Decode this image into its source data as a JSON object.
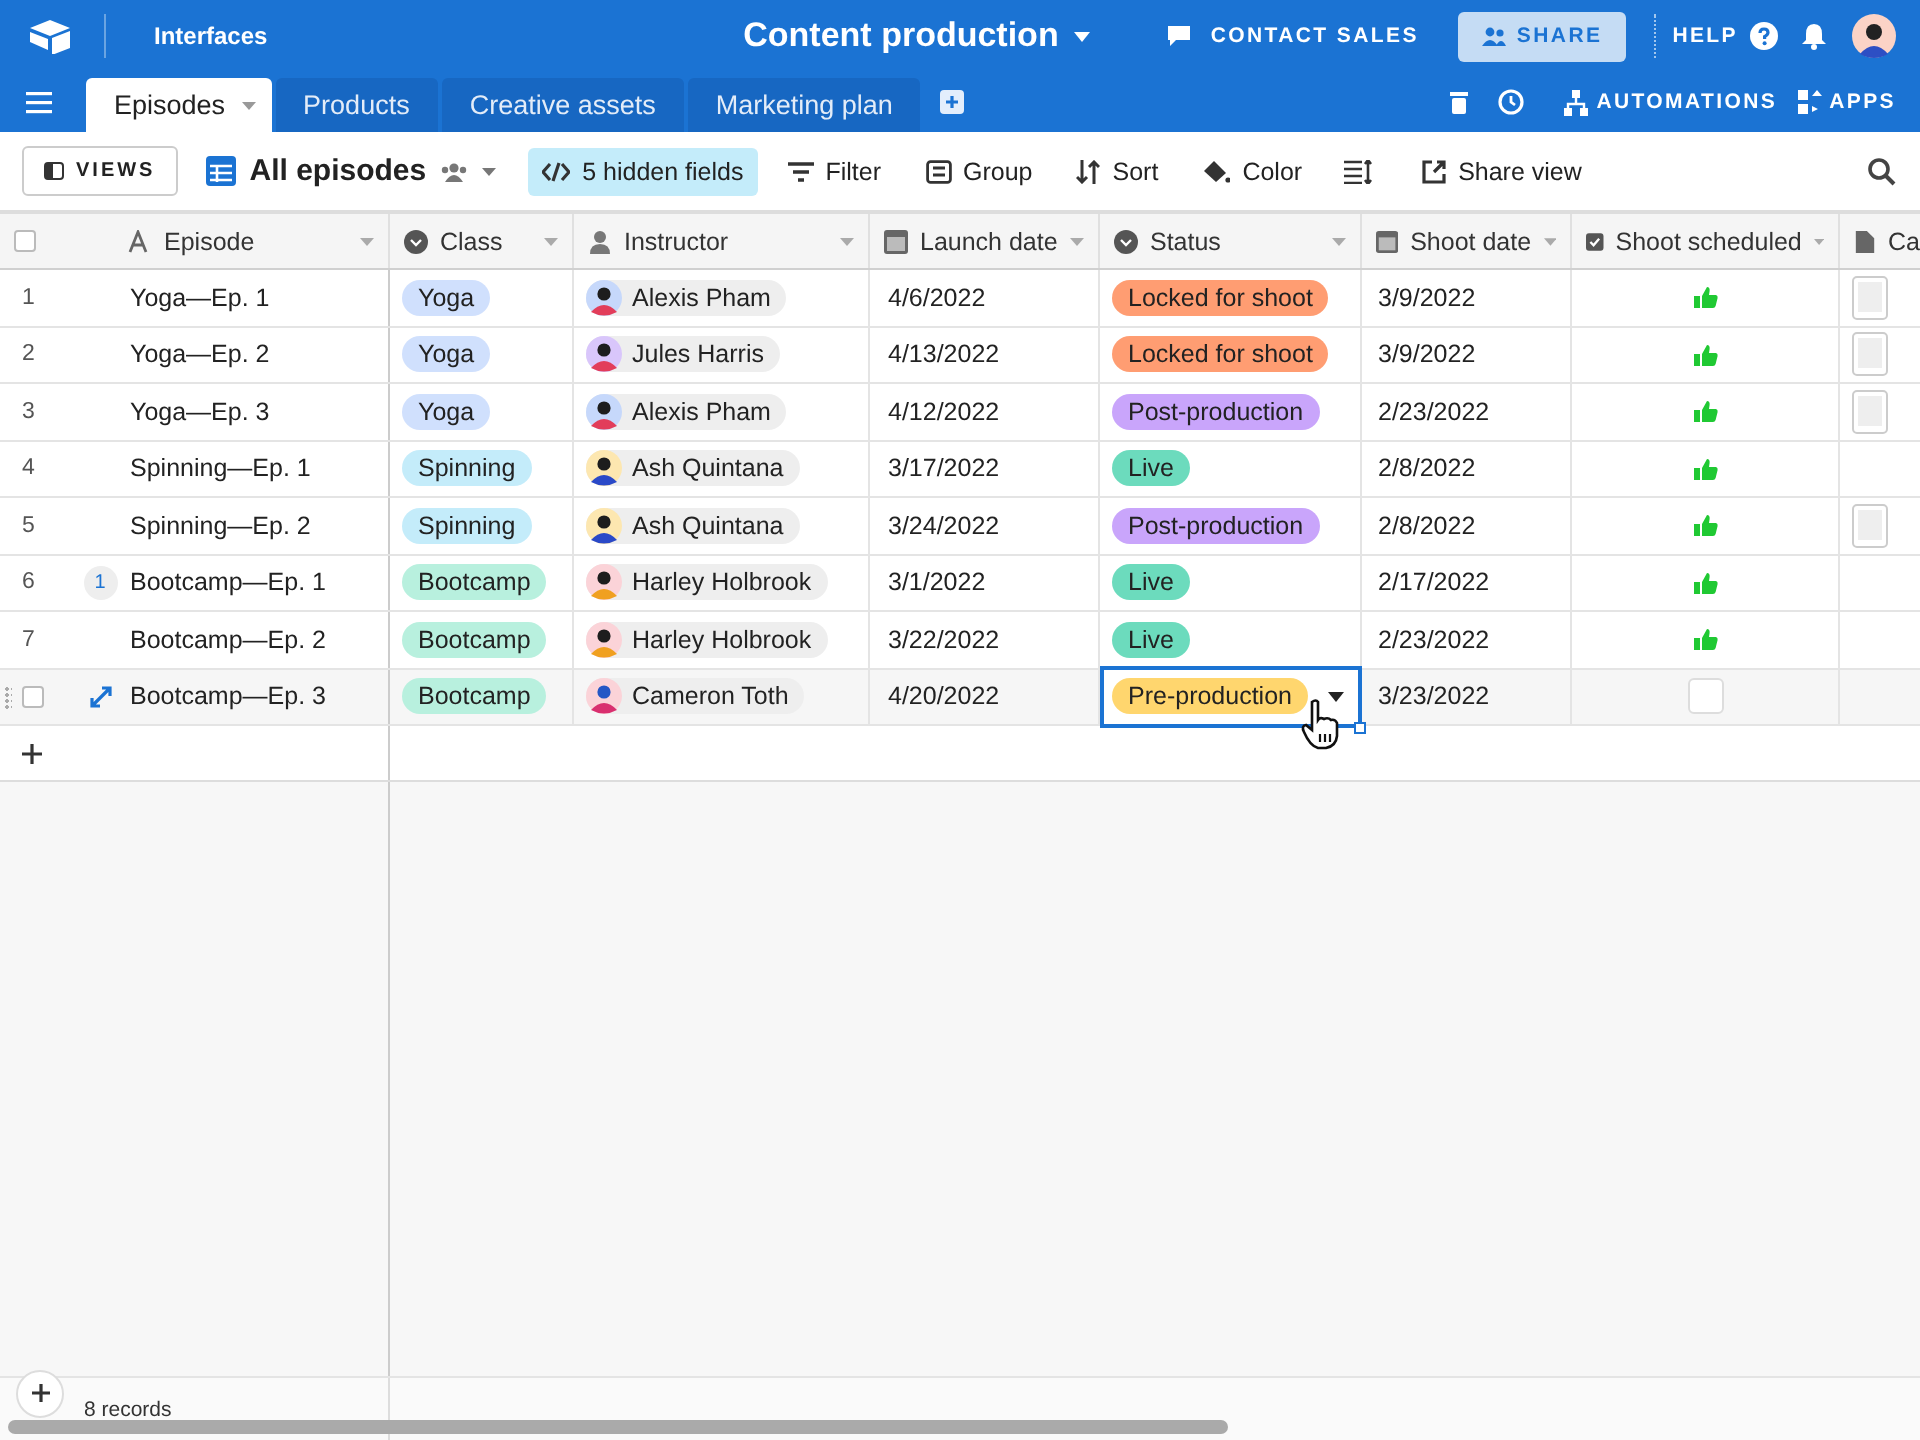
{
  "topbar": {
    "section": "Interfaces",
    "title": "Content production",
    "contact": "CONTACT SALES",
    "share": "SHARE",
    "help": "HELP"
  },
  "tabs": [
    {
      "label": "Episodes",
      "selected": true
    },
    {
      "label": "Products",
      "selected": false
    },
    {
      "label": "Creative assets",
      "selected": false
    },
    {
      "label": "Marketing plan",
      "selected": false
    }
  ],
  "tab_actions": {
    "automations": "AUTOMATIONS",
    "apps": "APPS"
  },
  "toolbar": {
    "views": "VIEWS",
    "view_name": "All episodes",
    "hidden": "5 hidden fields",
    "filter": "Filter",
    "group": "Group",
    "sort": "Sort",
    "color_label": "Color",
    "share_view": "Share view"
  },
  "all_checked": false,
  "columns": [
    {
      "label": "Episode",
      "kind": "text"
    },
    {
      "label": "Class",
      "kind": "select"
    },
    {
      "label": "Instructor",
      "kind": "user"
    },
    {
      "label": "Launch date",
      "kind": "date"
    },
    {
      "label": "Status",
      "kind": "select"
    },
    {
      "label": "Shoot date",
      "kind": "date"
    },
    {
      "label": "Shoot scheduled",
      "kind": "check"
    },
    {
      "label": "Ca",
      "kind": "file"
    }
  ],
  "rows": [
    {
      "number": "1",
      "episode": "Yoga—Ep. 1",
      "class": {
        "label": "Yoga",
        "color": "#d0e0fd"
      },
      "instructor": "Alexis Pham",
      "launch": "4/6/2022",
      "status": {
        "label": "Locked for shoot",
        "color": "#ff9d72"
      },
      "shoot": "3/9/2022",
      "scheduled": true,
      "attachment": true,
      "selected": false
    },
    {
      "number": "2",
      "episode": "Yoga—Ep. 2",
      "class": {
        "label": "Yoga",
        "color": "#d0e0fd"
      },
      "instructor": "Jules Harris",
      "launch": "4/13/2022",
      "status": {
        "label": "Locked for shoot",
        "color": "#ff9d72"
      },
      "shoot": "3/9/2022",
      "scheduled": true,
      "attachment": true,
      "selected": false
    },
    {
      "number": "3",
      "episode": "Yoga—Ep. 3",
      "class": {
        "label": "Yoga",
        "color": "#d0e0fd"
      },
      "instructor": "Alexis Pham",
      "launch": "4/12/2022",
      "status": {
        "label": "Post-production",
        "color": "#c9a5fb"
      },
      "shoot": "2/23/2022",
      "scheduled": true,
      "attachment": true,
      "selected": false
    },
    {
      "number": "4",
      "episode": "Spinning—Ep. 1",
      "class": {
        "label": "Spinning",
        "color": "#c4ecfa"
      },
      "instructor": "Ash Quintana",
      "launch": "3/17/2022",
      "status": {
        "label": "Live",
        "color": "#6cdbbd"
      },
      "shoot": "2/8/2022",
      "scheduled": true,
      "attachment": false,
      "selected": false
    },
    {
      "number": "5",
      "episode": "Spinning—Ep. 2",
      "class": {
        "label": "Spinning",
        "color": "#c4ecfa"
      },
      "instructor": "Ash Quintana",
      "launch": "3/24/2022",
      "status": {
        "label": "Post-production",
        "color": "#c9a5fb"
      },
      "shoot": "2/8/2022",
      "scheduled": true,
      "attachment": true,
      "selected": false
    },
    {
      "number": "6",
      "comments": "1",
      "episode": "Bootcamp—Ep. 1",
      "class": {
        "label": "Bootcamp",
        "color": "#b8f0de"
      },
      "instructor": "Harley Holbrook",
      "launch": "3/1/2022",
      "status": {
        "label": "Live",
        "color": "#6cdbbd"
      },
      "shoot": "2/17/2022",
      "scheduled": true,
      "attachment": false,
      "selected": false
    },
    {
      "number": "7",
      "episode": "Bootcamp—Ep. 2",
      "class": {
        "label": "Bootcamp",
        "color": "#b8f0de"
      },
      "instructor": "Harley Holbrook",
      "launch": "3/22/2022",
      "status": {
        "label": "Live",
        "color": "#6cdbbd"
      },
      "shoot": "2/23/2022",
      "scheduled": true,
      "attachment": false,
      "selected": false
    },
    {
      "episode": "Bootcamp—Ep. 3",
      "class": {
        "label": "Bootcamp",
        "color": "#b8f0de"
      },
      "instructor": "Cameron Toth",
      "launch": "4/20/2022",
      "status": {
        "label": "Pre-production",
        "color": "#ffd66e"
      },
      "shoot": "3/23/2022",
      "scheduled": false,
      "attachment": false,
      "selected": true
    }
  ],
  "footer": {
    "records": "8 records"
  }
}
